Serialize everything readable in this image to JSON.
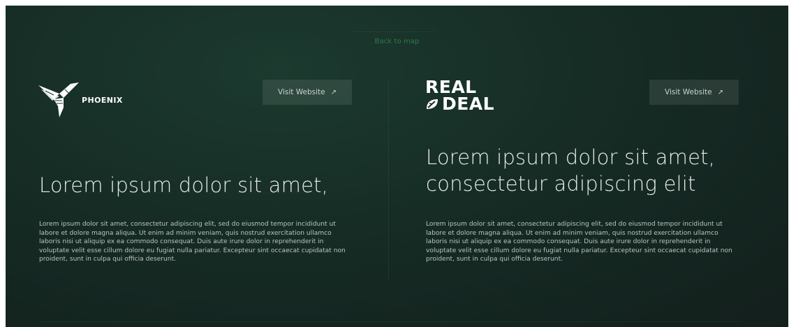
{
  "nav": {
    "back_label": "Back to map"
  },
  "partners": [
    {
      "logo_text": "PHOENIX",
      "visit_label": "Visit Website",
      "visit_icon": "arrow-up-right-icon",
      "headline": "Lorem ipsum dolor sit amet,",
      "body": "Lorem ipsum dolor sit amet, consectetur adipiscing elit, sed do eiusmod tempor incididunt ut labore et dolore magna aliqua. Ut enim ad minim veniam, quis nostrud exercitation ullamco laboris nisi ut aliquip ex ea commodo consequat. Duis aute irure dolor in reprehenderit in voluptate velit esse cillum dolore eu fugiat nulla pariatur. Excepteur sint occaecat cupidatat non proident, sunt in culpa qui officia deserunt."
    },
    {
      "logo_text_line1": "REAL",
      "logo_text_line2": "DEAL",
      "visit_label": "Visit Website",
      "visit_icon": "arrow-up-right-icon",
      "headline_line1": "Lorem ipsum dolor sit amet,",
      "headline_line2": "consectetur adipiscing elit",
      "body": "Lorem ipsum dolor sit amet, consectetur adipiscing elit, sed do eiusmod tempor incididunt ut labore et dolore magna aliqua. Ut enim ad minim veniam, quis nostrud exercitation ullamco laboris nisi ut aliquip ex ea commodo consequat. Duis aute irure dolor in reprehenderit in voluptate velit esse cillum dolore eu fugiat nulla pariatur. Excepteur sint occaecat cupidatat non proident, sunt in culpa qui officia deserunt."
    }
  ],
  "colors": {
    "background": "#162c25",
    "back_link": "#2c7a4f",
    "headline": "#e6ece9",
    "body_text": "#b9c5bf"
  }
}
